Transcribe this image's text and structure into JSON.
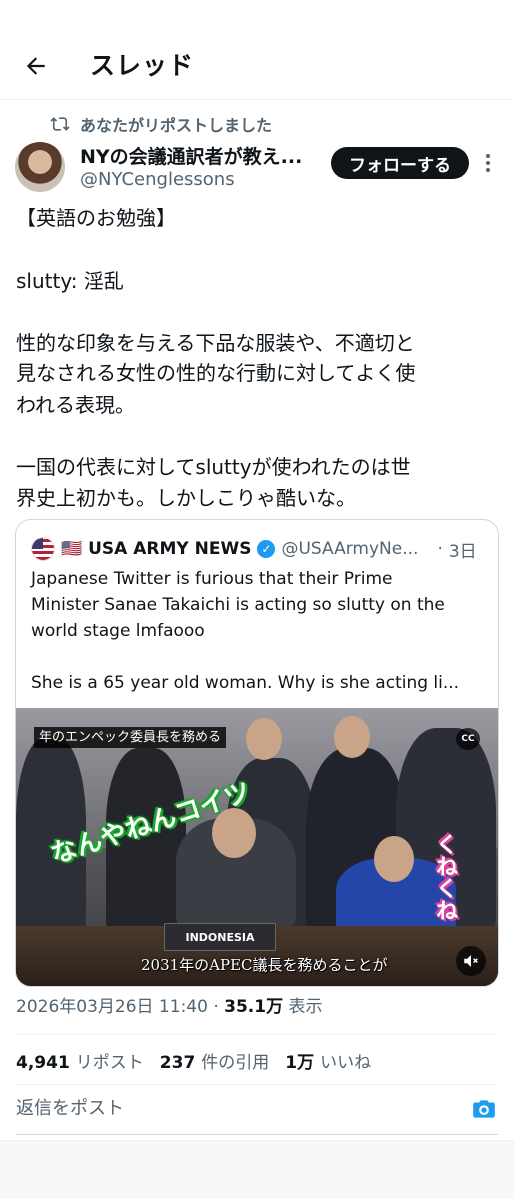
{
  "header": {
    "title": "スレッド"
  },
  "repost": {
    "label": "あなたがリポストしました"
  },
  "author": {
    "name": "NYの会議通訳者が教え...",
    "handle": "@NYCenglessons"
  },
  "follow_label": "フォローする",
  "post": {
    "lines": [
      "【英語のお勉強】",
      "slutty: 淫乱",
      "性的な印象を与える下品な服装や、不適切と",
      "見なされる女性の性的な行動に対してよく使",
      "われる表現。",
      "一国の代表に対してsluttyが使われたのは世",
      "界史上初かも。しかしこりゃ酷いな。"
    ]
  },
  "quote": {
    "name": "🇺🇸 USA ARMY NEWS",
    "handle": "@USAArmyNe...",
    "separator": "·",
    "time": "3日",
    "lines": [
      "Japanese Twitter is furious that their Prime",
      "Minister Sanae Takaichi is acting so slutty on the",
      "world stage lmfaooo",
      "She is a 65 year old woman. Why is she acting li..."
    ],
    "video": {
      "caption_top": "年のエンペック委員長を務める",
      "cc_label": "CC",
      "overlay_green": "なんやねんコイツ",
      "overlay_pink": "くねくね",
      "placard": "INDONESIA",
      "caption_bottom": "2031年のAPEC議長を務めることが"
    }
  },
  "meta": {
    "timestamp": "2026年03月26日 11:40 · ",
    "views_value": "35.1万",
    "views_label": " 表示"
  },
  "stats": [
    {
      "value": "4,941",
      "label": "リポスト"
    },
    {
      "value": "237",
      "label": "件の引用"
    },
    {
      "value": "1万",
      "label": "いいね"
    }
  ],
  "reply": {
    "placeholder": "返信をポスト"
  },
  "icons": {
    "back": "arrow-left-icon",
    "repost": "repost-icon",
    "more": "more-vertical-icon",
    "verified": "verified-badge-icon",
    "camera": "camera-icon",
    "mute": "mute-icon"
  },
  "colors": {
    "accent": "#1d9bf0",
    "text": "#0f1419",
    "secondary": "#536471"
  }
}
